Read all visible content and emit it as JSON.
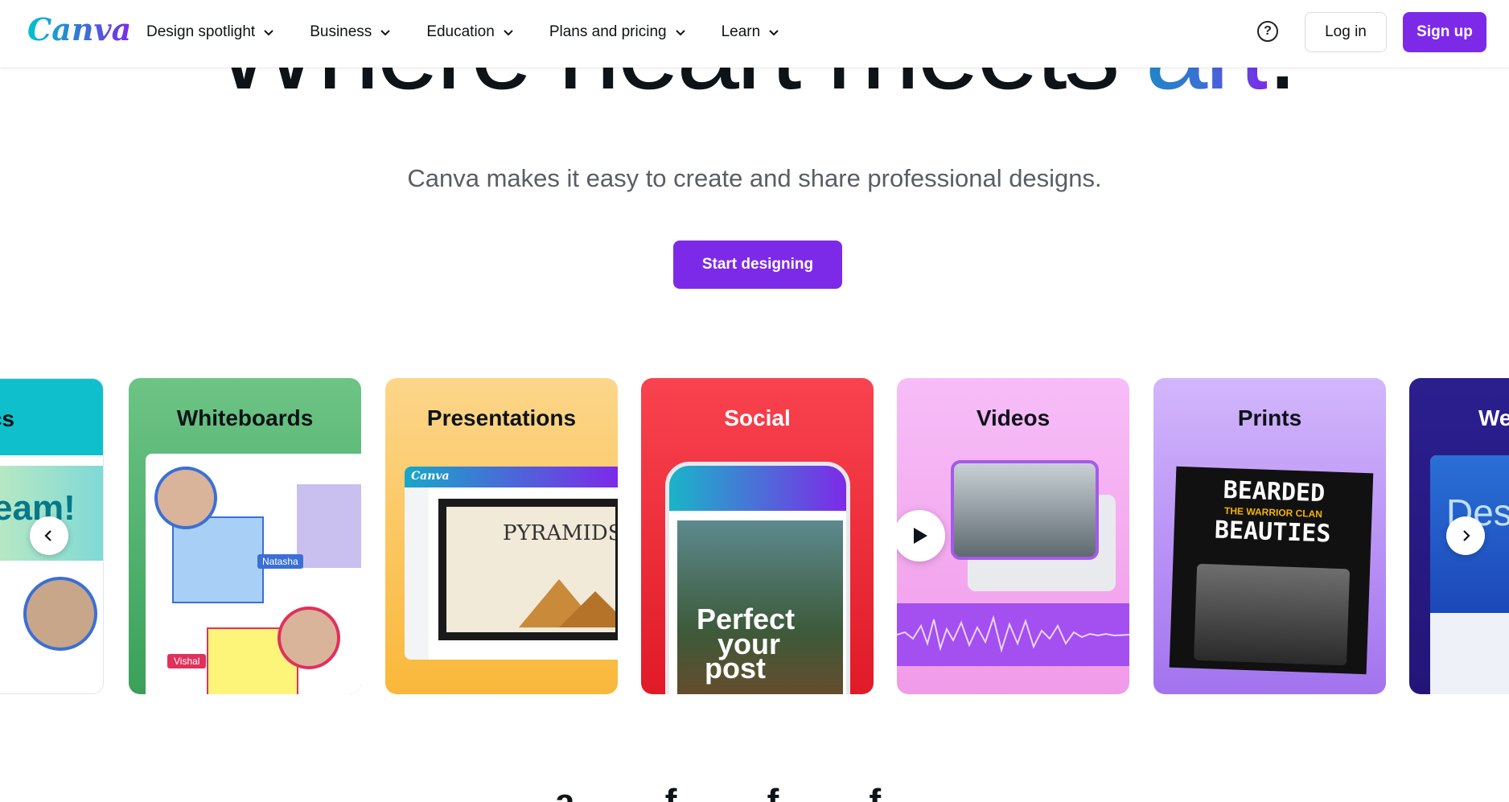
{
  "nav": {
    "logo": "Canva",
    "menu": [
      {
        "label": "Design spotlight"
      },
      {
        "label": "Business"
      },
      {
        "label": "Education"
      },
      {
        "label": "Plans and pricing"
      },
      {
        "label": "Learn"
      }
    ],
    "help_icon": "?",
    "login_label": "Log in",
    "signup_label": "Sign up"
  },
  "hero": {
    "title_main": "Where heart meets ",
    "title_accent": "art",
    "title_end": ".",
    "subtitle": "Canva makes it easy to create and share professional designs.",
    "cta_label": "Start designing"
  },
  "carousel": {
    "cards": [
      {
        "title": "cs",
        "color": "#00c4cc"
      },
      {
        "title": "Whiteboards",
        "color": "#5bbd72"
      },
      {
        "title": "Presentations",
        "color": "#fcc86a"
      },
      {
        "title": "Social",
        "color": "#f7323f"
      },
      {
        "title": "Videos",
        "color": "#f5b6f7"
      },
      {
        "title": "Prints",
        "color": "#c9a6fb"
      },
      {
        "title": "We",
        "color": "#2a1a8a"
      }
    ],
    "whiteboard_names": [
      "Natasha",
      "Vishal"
    ],
    "presentation_text": "PYRAMIDS",
    "presentation_logo": "Canva",
    "social_text": [
      "Perfect",
      "your",
      "post"
    ],
    "prints_text": [
      "BEARDED",
      "BEAUTIES",
      "THE WARRIOR CLAN"
    ],
    "web_partial": "Des",
    "team_partial": "eam!"
  },
  "bottom_peek": "a f f f"
}
